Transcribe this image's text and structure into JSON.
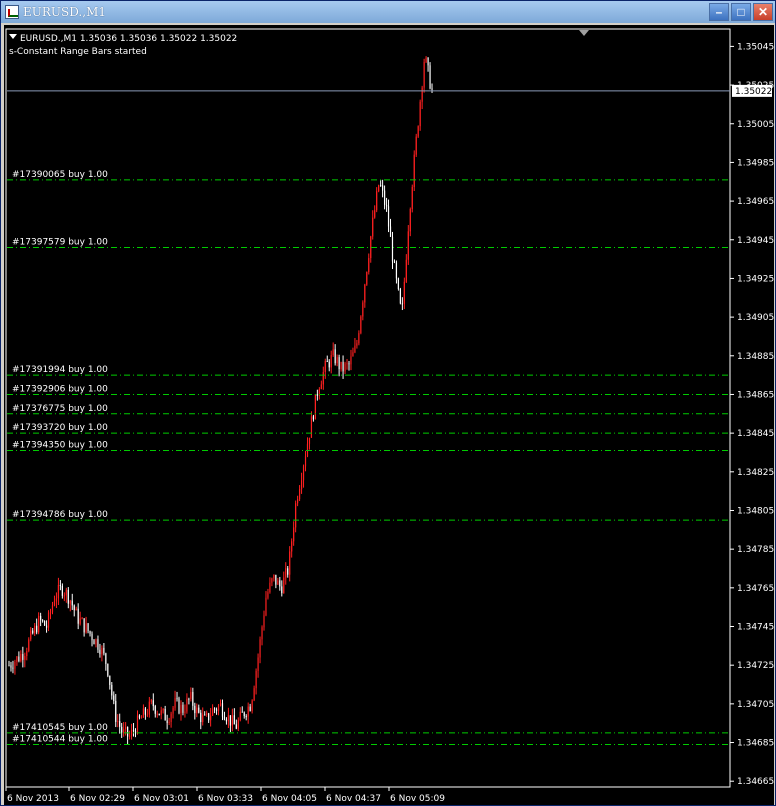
{
  "window": {
    "title": "EURUSD.,M1",
    "minimize_icon": "minimize-icon",
    "maximize_icon": "maximize-icon",
    "close_icon": "close-icon"
  },
  "chart_header": {
    "symbol_line": "EURUSD.,M1  1.35036 1.35036 1.35022 1.35022",
    "indicator_line": "s-Constant Range Bars started"
  },
  "chart_data": {
    "type": "candlestick",
    "y_axis_ticks": [
      "1.35045",
      "1.35025",
      "1.35005",
      "1.34985",
      "1.34965",
      "1.34945",
      "1.34925",
      "1.34905",
      "1.34885",
      "1.34865",
      "1.34845",
      "1.34825",
      "1.34805",
      "1.34785",
      "1.34765",
      "1.34745",
      "1.34725",
      "1.34705",
      "1.34685",
      "1.34665"
    ],
    "y_range": [
      1.34662,
      1.35054
    ],
    "x_axis_ticks": [
      "6 Nov 2013",
      "6 Nov 02:29",
      "6 Nov 03:01",
      "6 Nov 03:33",
      "6 Nov 04:05",
      "6 Nov 04:37",
      "6 Nov 05:09"
    ],
    "current_price": "1.35022",
    "current_price_value": 1.35022,
    "order_lines": [
      {
        "label": "#17390065 buy 1.00",
        "price": 1.34976
      },
      {
        "label": "#17397579 buy 1.00",
        "price": 1.34941
      },
      {
        "label": "#17391994 buy 1.00",
        "price": 1.34875
      },
      {
        "label": "#17392906 buy 1.00",
        "price": 1.34865
      },
      {
        "label": "#17376775 buy 1.00",
        "price": 1.34855
      },
      {
        "label": "#17393720 buy 1.00",
        "price": 1.34845
      },
      {
        "label": "#17394350 buy 1.00",
        "price": 1.34836
      },
      {
        "label": "#17394786 buy 1.00",
        "price": 1.348
      },
      {
        "label": "#17410545 buy 1.00",
        "price": 1.3469
      },
      {
        "label": "#17410544 buy 1.00",
        "price": 1.34684
      }
    ],
    "close_path": [
      1.34725,
      1.34728,
      1.34732,
      1.3474,
      1.34748,
      1.34745,
      1.3476,
      1.34765,
      1.3476,
      1.3475,
      1.34745,
      1.3474,
      1.34735,
      1.34725,
      1.347,
      1.3469,
      1.34688,
      1.34695,
      1.347,
      1.34705,
      1.347,
      1.34698,
      1.34705,
      1.34702,
      1.34708,
      1.347,
      1.34696,
      1.34702,
      1.34704,
      1.34698,
      1.34693,
      1.347,
      1.34705,
      1.3473,
      1.3476,
      1.3477,
      1.34765,
      1.34775,
      1.3481,
      1.3483,
      1.3485,
      1.3487,
      1.3488,
      1.34885,
      1.34878,
      1.3488,
      1.3489,
      1.3492,
      1.3495,
      1.34975,
      1.3496,
      1.3493,
      1.34905,
      1.3496,
      1.35,
      1.3504,
      1.35022
    ]
  },
  "colors": {
    "background": "#000000",
    "bull_candle": "#ff2020",
    "bear_candle": "#ffffff",
    "order_line": "#00cc00",
    "bid_line": "#8a9ab8",
    "axis": "#ffffff"
  }
}
